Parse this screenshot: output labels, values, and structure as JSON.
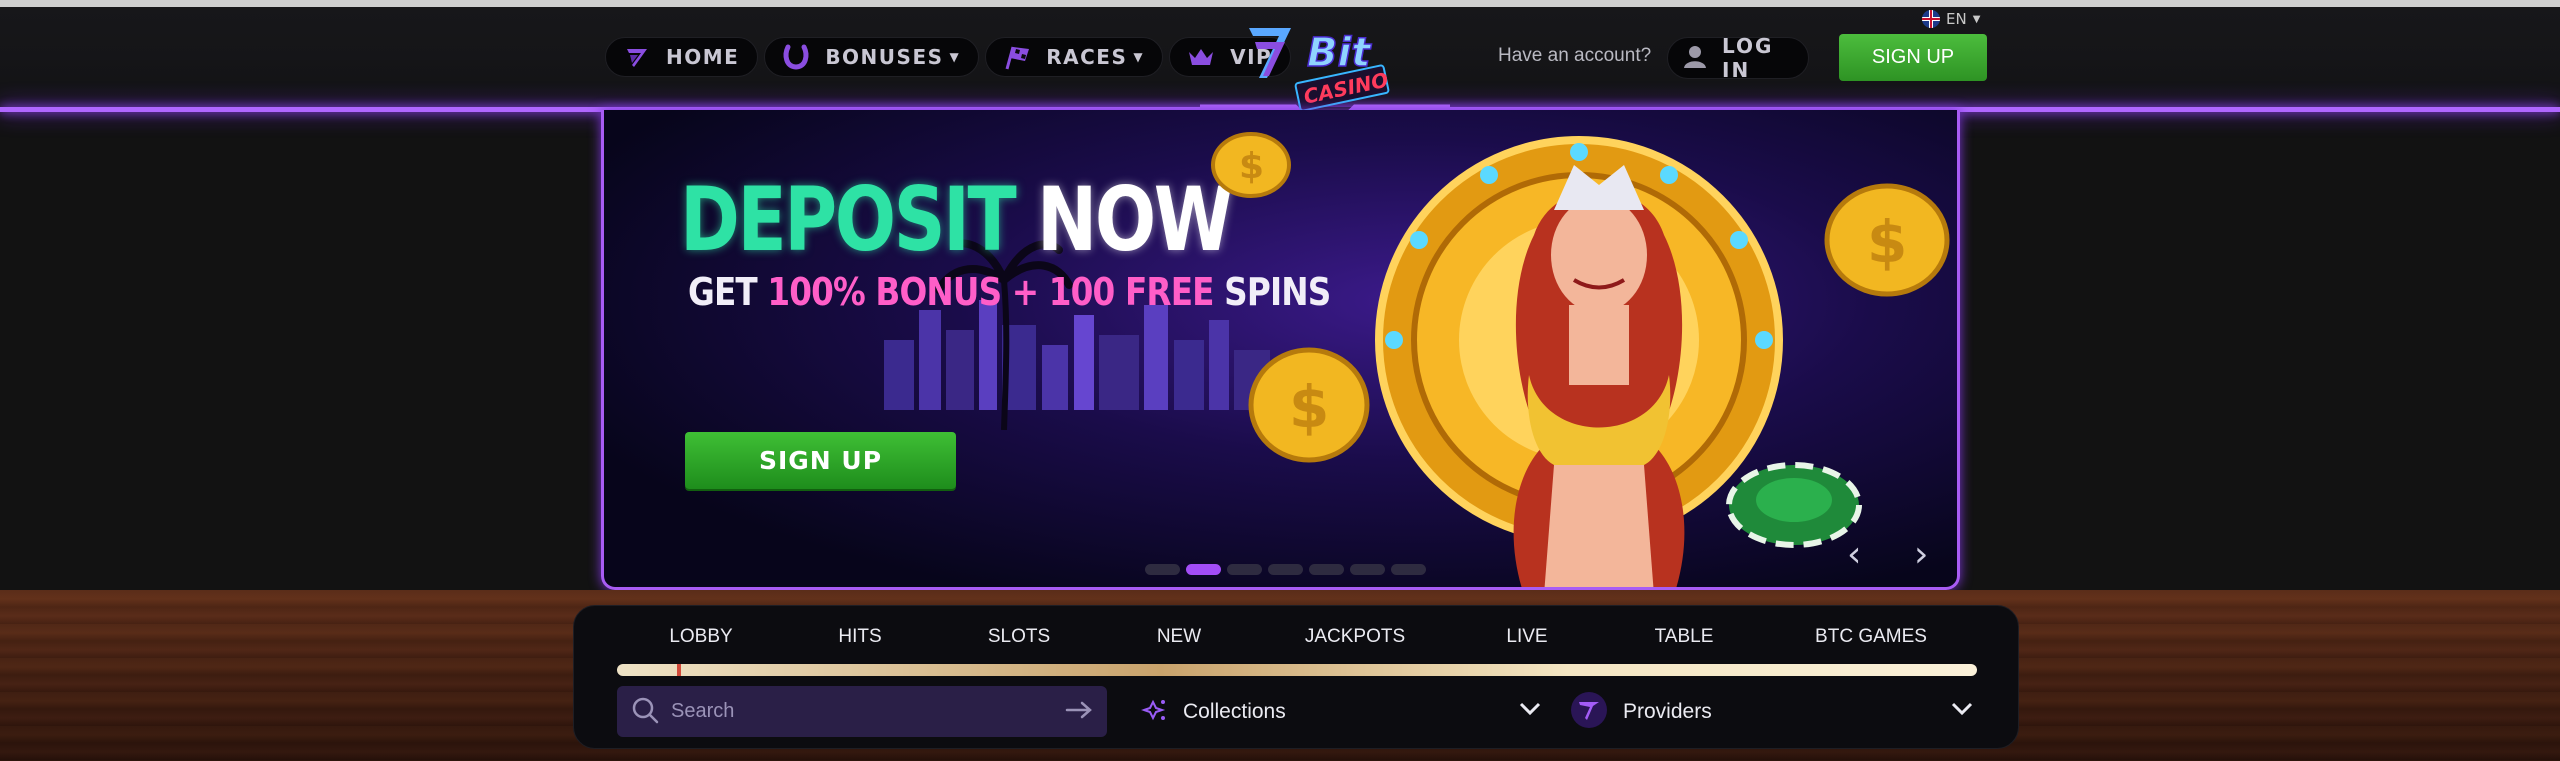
{
  "header": {
    "nav": [
      {
        "label": "HOME",
        "icon": "bitcasino-mark-icon",
        "has_dropdown": false
      },
      {
        "label": "BONUSES",
        "icon": "horseshoe-icon",
        "has_dropdown": true
      },
      {
        "label": "RACES",
        "icon": "racing-flag-icon",
        "has_dropdown": true
      },
      {
        "label": "VIP",
        "icon": "crown-icon",
        "has_dropdown": false
      }
    ],
    "logo": {
      "line1": "Bit",
      "line2": "CASINO"
    },
    "language": "EN",
    "have_account": "Have an account?",
    "login_label": "LOG IN",
    "signup_label": "SIGN UP"
  },
  "banner": {
    "title_green": "DEPOSIT",
    "title_white": "NOW",
    "subtitle_get": "GET",
    "subtitle_bonus": "100% BONUS + 100 FREE",
    "subtitle_spins": "SPINS",
    "cta_label": "SIGN UP",
    "slides_total": 7,
    "slide_active": 2,
    "prev_arrow": "‹",
    "next_arrow": "›"
  },
  "games": {
    "tabs": [
      "LOBBY",
      "HITS",
      "SLOTS",
      "NEW",
      "JACKPOTS",
      "LIVE",
      "TABLE",
      "BTC GAMES"
    ],
    "active_tab": "LOBBY",
    "search_placeholder": "Search",
    "collections_label": "Collections",
    "providers_label": "Providers"
  },
  "colors": {
    "accent_purple": "#a85cf4",
    "green_button": "#3fa533",
    "title_green": "#2ee2a5",
    "bonus_pink": "#ff5ec8"
  }
}
